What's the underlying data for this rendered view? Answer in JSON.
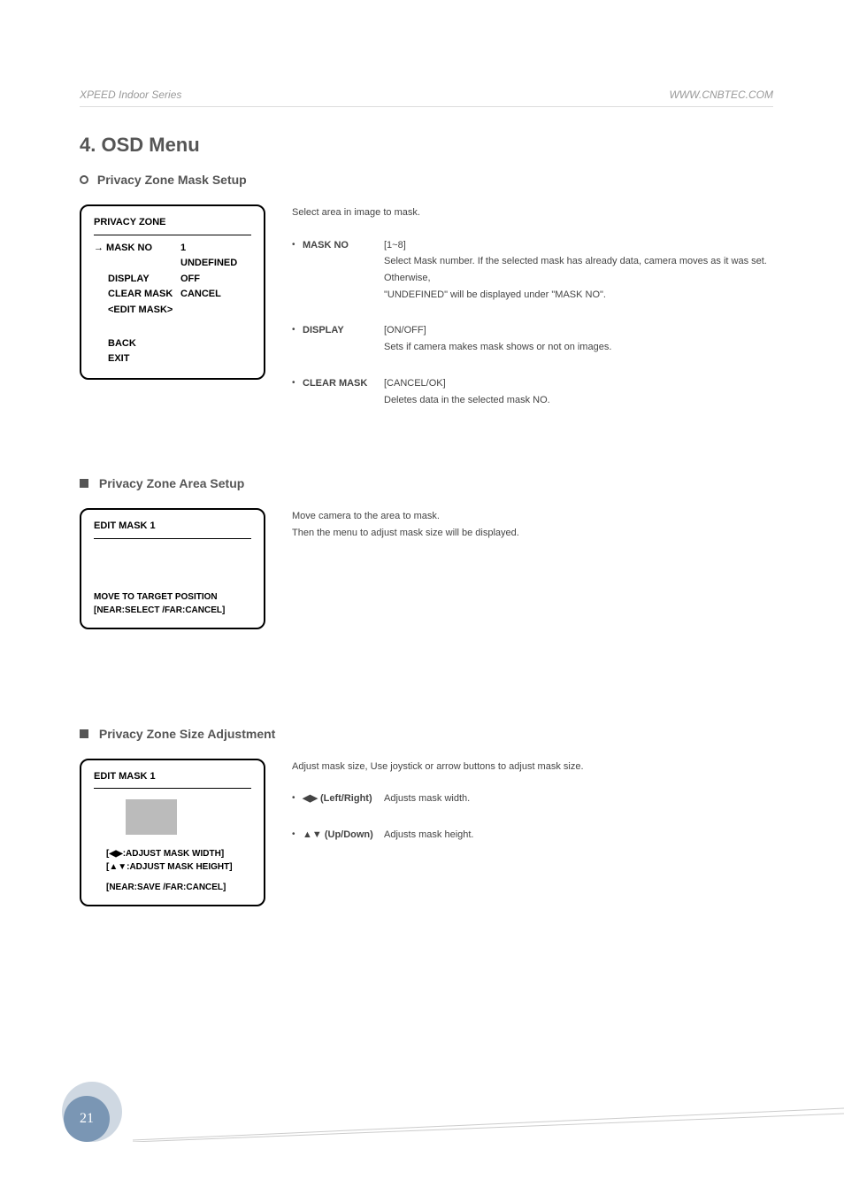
{
  "header": {
    "left": "XPEED Indoor Series",
    "right": "WWW.CNBTEC.COM"
  },
  "title": "4. OSD Menu",
  "s1": {
    "title": "Privacy Zone Mask Setup",
    "panel": {
      "title": "PRIVACY ZONE",
      "row1_label": "→ MASK NO",
      "row1_val": "1",
      "row1_sub": "UNDEFINED",
      "row2_label": "DISPLAY",
      "row2_val": "OFF",
      "row3_label": "CLEAR MASK",
      "row3_val": "CANCEL",
      "row4_label": "<EDIT MASK>",
      "back": "BACK",
      "exit": "EXIT"
    },
    "intro": "Select area in image to mask.",
    "items": [
      {
        "key": "MASK NO",
        "line1": "[1~8]",
        "line2": "Select Mask number. If the selected mask has already data, camera moves as it was set. Otherwise,",
        "line3": "\"UNDEFINED\" will be displayed under \"MASK NO\"."
      },
      {
        "key": "DISPLAY",
        "line1": "[ON/OFF]",
        "line2": "Sets if camera makes mask shows or not on images."
      },
      {
        "key": "CLEAR MASK",
        "line1": "[CANCEL/OK]",
        "line2": "Deletes data in the selected mask NO."
      }
    ]
  },
  "s2": {
    "title": "Privacy Zone Area Setup",
    "panel": {
      "title": "EDIT MASK 1",
      "f1": "MOVE TO TARGET POSITION",
      "f2": "[NEAR:SELECT /FAR:CANCEL]"
    },
    "d1": "Move camera to the area to mask.",
    "d2": "Then the menu to adjust mask size will be displayed."
  },
  "s3": {
    "title": "Privacy Zone Size Adjustment",
    "panel": {
      "title": "EDIT MASK 1",
      "f1": "[◀▶:ADJUST MASK WIDTH]",
      "f2": "[▲▼:ADJUST MASK HEIGHT]",
      "f3": "[NEAR:SAVE   /FAR:CANCEL]"
    },
    "intro": "Adjust mask size, Use joystick or arrow buttons to adjust mask size.",
    "items": [
      {
        "key": "◀▶ (Left/Right)",
        "text": "Adjusts mask width."
      },
      {
        "key": "▲▼ (Up/Down)",
        "text": "Adjusts mask height."
      }
    ]
  },
  "pagenum": "21"
}
